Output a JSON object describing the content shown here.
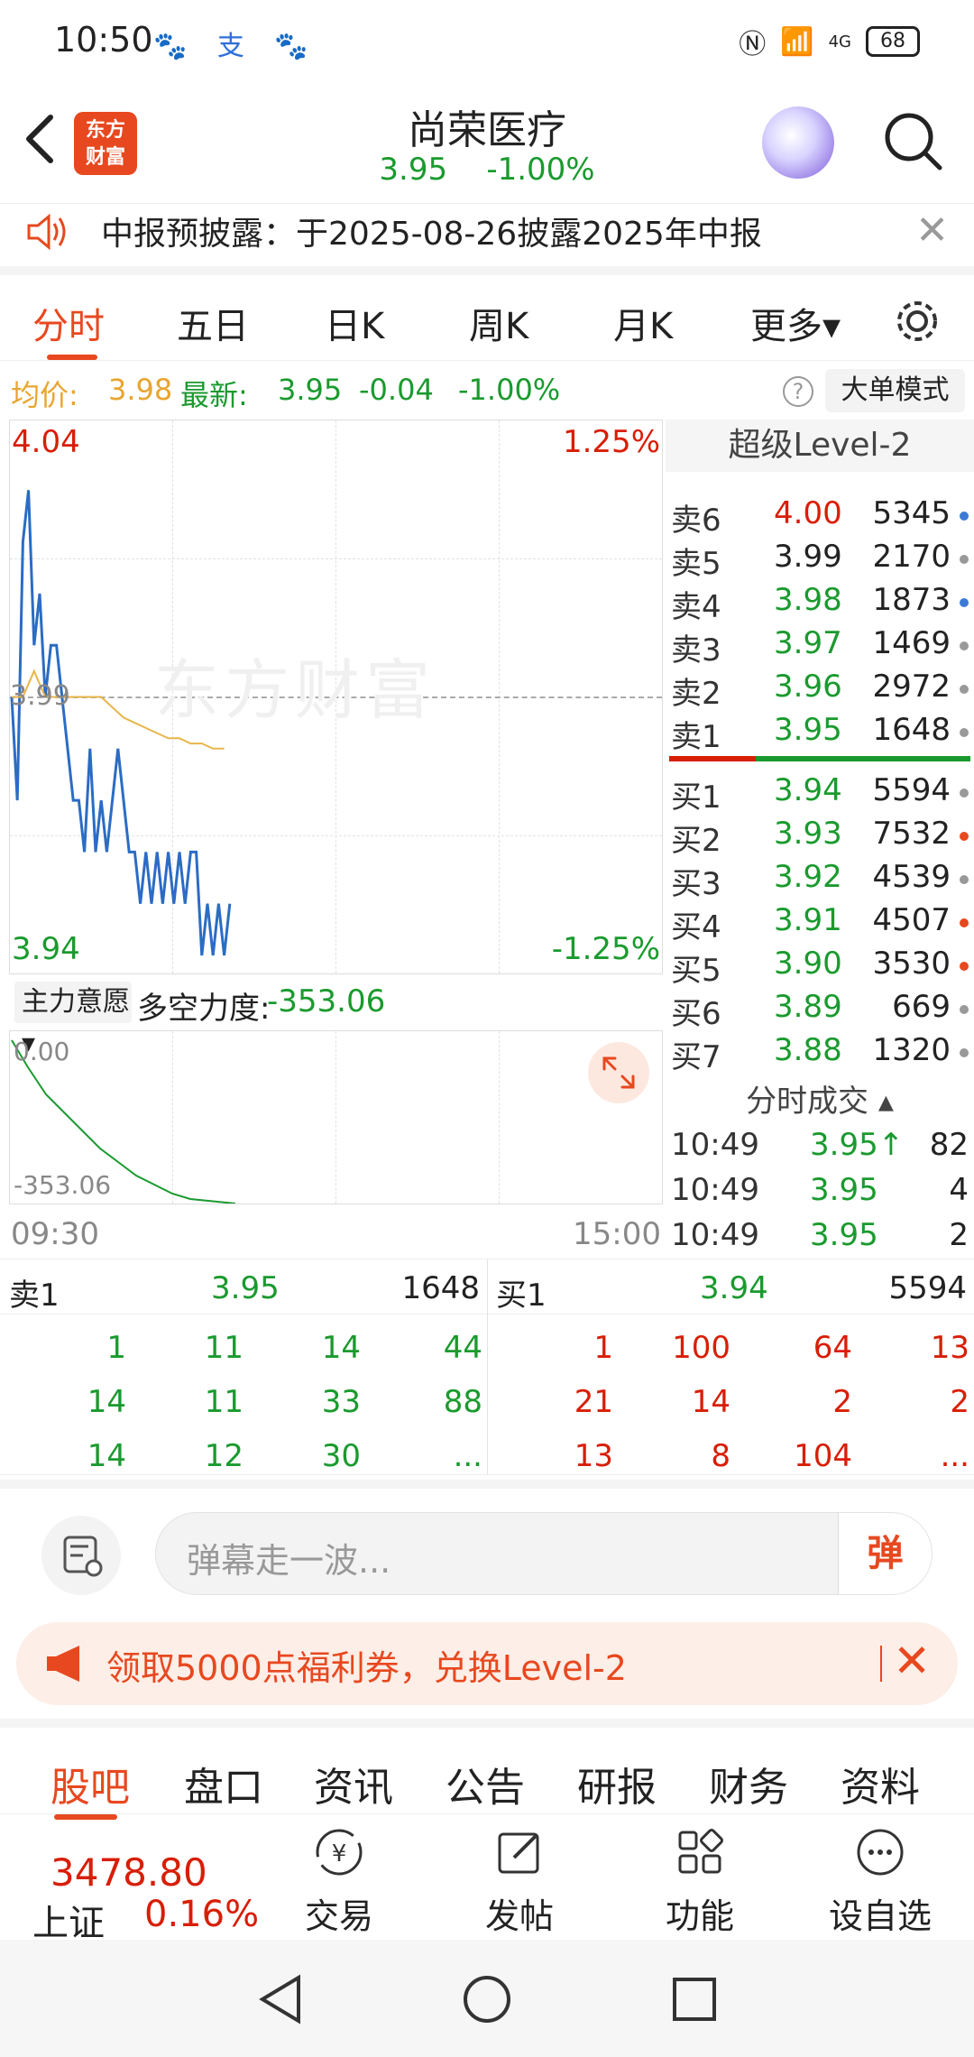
{
  "status_bar": {
    "time": "10:50",
    "icons": "🐾 支 🐾",
    "battery": "68",
    "signal": "4G"
  },
  "header": {
    "back_icon": "chevron-left-icon",
    "logo_text": "东方\n财富",
    "stock_name": "尚荣医疗",
    "price": "3.95",
    "change_pct": "-1.00%",
    "search_icon": "search-icon"
  },
  "notice": {
    "text": "中报预披露：于2025-08-26披露2025年中报",
    "close": "✕"
  },
  "chart_tabs": {
    "items": [
      "分时",
      "五日",
      "日K",
      "周K",
      "月K",
      "更多▾"
    ],
    "active_index": 0
  },
  "avg_row": {
    "avg_label": "均价:",
    "avg_value": "3.98",
    "latest_label": "最新:",
    "latest_value": "3.95",
    "change": "-0.04",
    "change_pct": "-1.00%",
    "big_mode": "大单模式",
    "help": "?"
  },
  "chart": {
    "y_top": "4.04",
    "y_bottom": "3.94",
    "y_mid": "3.99",
    "pct_top": "1.25%",
    "pct_bottom": "-1.25%",
    "watermark": "东方财富",
    "colors": {
      "price_line": "#2b6cc4",
      "avg_line": "#e8b64a",
      "up": "#d81e06",
      "down": "#1a9a2e"
    }
  },
  "chart_data": {
    "type": "line",
    "ylim": [
      3.94,
      4.04
    ],
    "series": [
      {
        "values": [
          3.99,
          3.97,
          4.02,
          4.03,
          4.0,
          4.01,
          3.99,
          4.0,
          4.0,
          3.99,
          3.98,
          3.97,
          3.97,
          3.96,
          3.98,
          3.96,
          3.97,
          3.96,
          3.97,
          3.98,
          3.97,
          3.96,
          3.96,
          3.95,
          3.96,
          3.95,
          3.96,
          3.95,
          3.96,
          3.95,
          3.96,
          3.95,
          3.96,
          3.96,
          3.94,
          3.95,
          3.94,
          3.95,
          3.94,
          3.95
        ]
      },
      {
        "values": [
          3.99,
          3.99,
          3.995,
          3.99,
          3.99,
          3.99,
          3.99,
          3.99,
          3.99,
          3.988,
          3.986,
          3.985,
          3.984,
          3.983,
          3.982,
          3.982,
          3.981,
          3.981,
          3.98,
          3.98
        ]
      }
    ],
    "x_start": "09:30",
    "x_end": "15:00"
  },
  "force": {
    "dropdown": "主力意愿 ▾",
    "label": "多空力度:",
    "value": "-353.06",
    "sub_top": "0.00",
    "sub_bottom": "-353.06",
    "expand_icon": "expand-icon"
  },
  "time_axis": {
    "start": "09:30",
    "end": "15:00"
  },
  "orderbook": {
    "title": "超级Level-2",
    "sells": [
      {
        "label": "卖6",
        "price": "4.00",
        "vol": "5345",
        "dot": "#3b7bd6"
      },
      {
        "label": "卖5",
        "price": "3.99",
        "vol": "2170",
        "dot": "#999999"
      },
      {
        "label": "卖4",
        "price": "3.98",
        "vol": "1873",
        "dot": "#3b7bd6"
      },
      {
        "label": "卖3",
        "price": "3.97",
        "vol": "1469",
        "dot": "#999999"
      },
      {
        "label": "卖2",
        "price": "3.96",
        "vol": "2972",
        "dot": "#999999"
      },
      {
        "label": "卖1",
        "price": "3.95",
        "vol": "1648",
        "dot": "#999999"
      }
    ],
    "buys": [
      {
        "label": "买1",
        "price": "3.94",
        "vol": "5594",
        "dot": "#999999"
      },
      {
        "label": "买2",
        "price": "3.93",
        "vol": "7532",
        "dot": "#e8481f"
      },
      {
        "label": "买3",
        "price": "3.92",
        "vol": "4539",
        "dot": "#999999"
      },
      {
        "label": "买4",
        "price": "3.91",
        "vol": "4507",
        "dot": "#e8481f"
      },
      {
        "label": "买5",
        "price": "3.90",
        "vol": "3530",
        "dot": "#e8481f"
      },
      {
        "label": "买6",
        "price": "3.89",
        "vol": "669",
        "dot": "#999999"
      },
      {
        "label": "买7",
        "price": "3.88",
        "vol": "1320",
        "dot": "#999999"
      }
    ],
    "trades_title": "分时成交 ▴",
    "trades": [
      {
        "time": "10:49",
        "price": "3.95↑",
        "vol": "82"
      },
      {
        "time": "10:49",
        "price": "3.95",
        "vol": "4"
      },
      {
        "time": "10:49",
        "price": "3.95",
        "vol": "2"
      }
    ]
  },
  "l1book": {
    "sell_label": "卖1",
    "sell_price": "3.95",
    "sell_vol": "1648",
    "buy_label": "买1",
    "buy_price": "3.94",
    "buy_vol": "5594",
    "sell_queue": [
      [
        "1",
        "11",
        "14",
        "44"
      ],
      [
        "14",
        "11",
        "33",
        "88"
      ],
      [
        "14",
        "12",
        "30",
        "..."
      ]
    ],
    "buy_queue": [
      [
        "1",
        "100",
        "64",
        "13"
      ],
      [
        "21",
        "14",
        "2",
        "2"
      ],
      [
        "13",
        "8",
        "104",
        "..."
      ]
    ]
  },
  "comment": {
    "placeholder": "弹幕走一波...",
    "button": "弹"
  },
  "promo": {
    "text": "领取5000点福利券，兑换Level-2",
    "close": "✕"
  },
  "bottom_tabs": {
    "items": [
      "股吧",
      "盘口",
      "资讯",
      "公告",
      "研报",
      "财务",
      "资料"
    ],
    "active_index": 0
  },
  "toolbar": {
    "index_value": "3478.80",
    "index_name": "上证",
    "index_pct": "0.16%",
    "items": [
      "交易",
      "发帖",
      "功能",
      "设自选"
    ]
  }
}
